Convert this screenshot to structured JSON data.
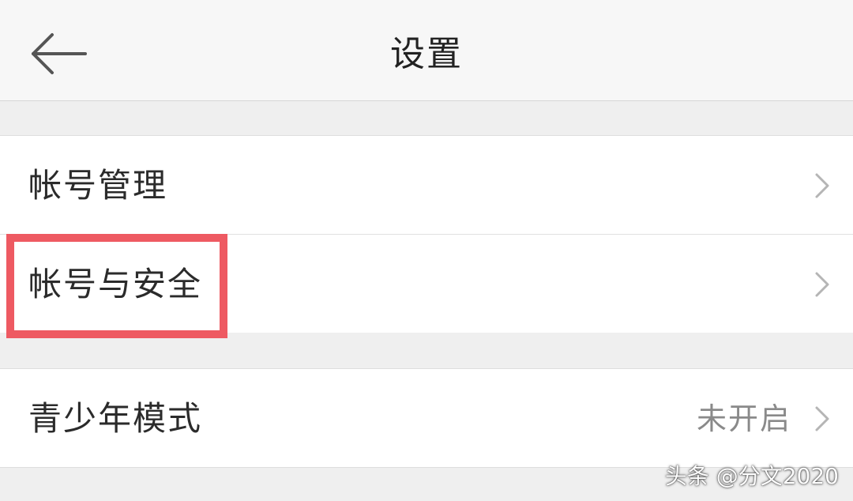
{
  "header": {
    "back_icon": "arrow-left-icon",
    "title": "设置"
  },
  "section1": {
    "items": [
      {
        "label": "帐号管理",
        "icon": "chevron-right-icon"
      },
      {
        "label": "帐号与安全",
        "icon": "chevron-right-icon",
        "highlighted": true
      }
    ]
  },
  "section2": {
    "items": [
      {
        "label": "青少年模式",
        "value": "未开启",
        "icon": "chevron-right-icon"
      }
    ]
  },
  "overlay": {
    "highlight_color": "#ee5a62",
    "watermark": "头条 @分文2020"
  }
}
